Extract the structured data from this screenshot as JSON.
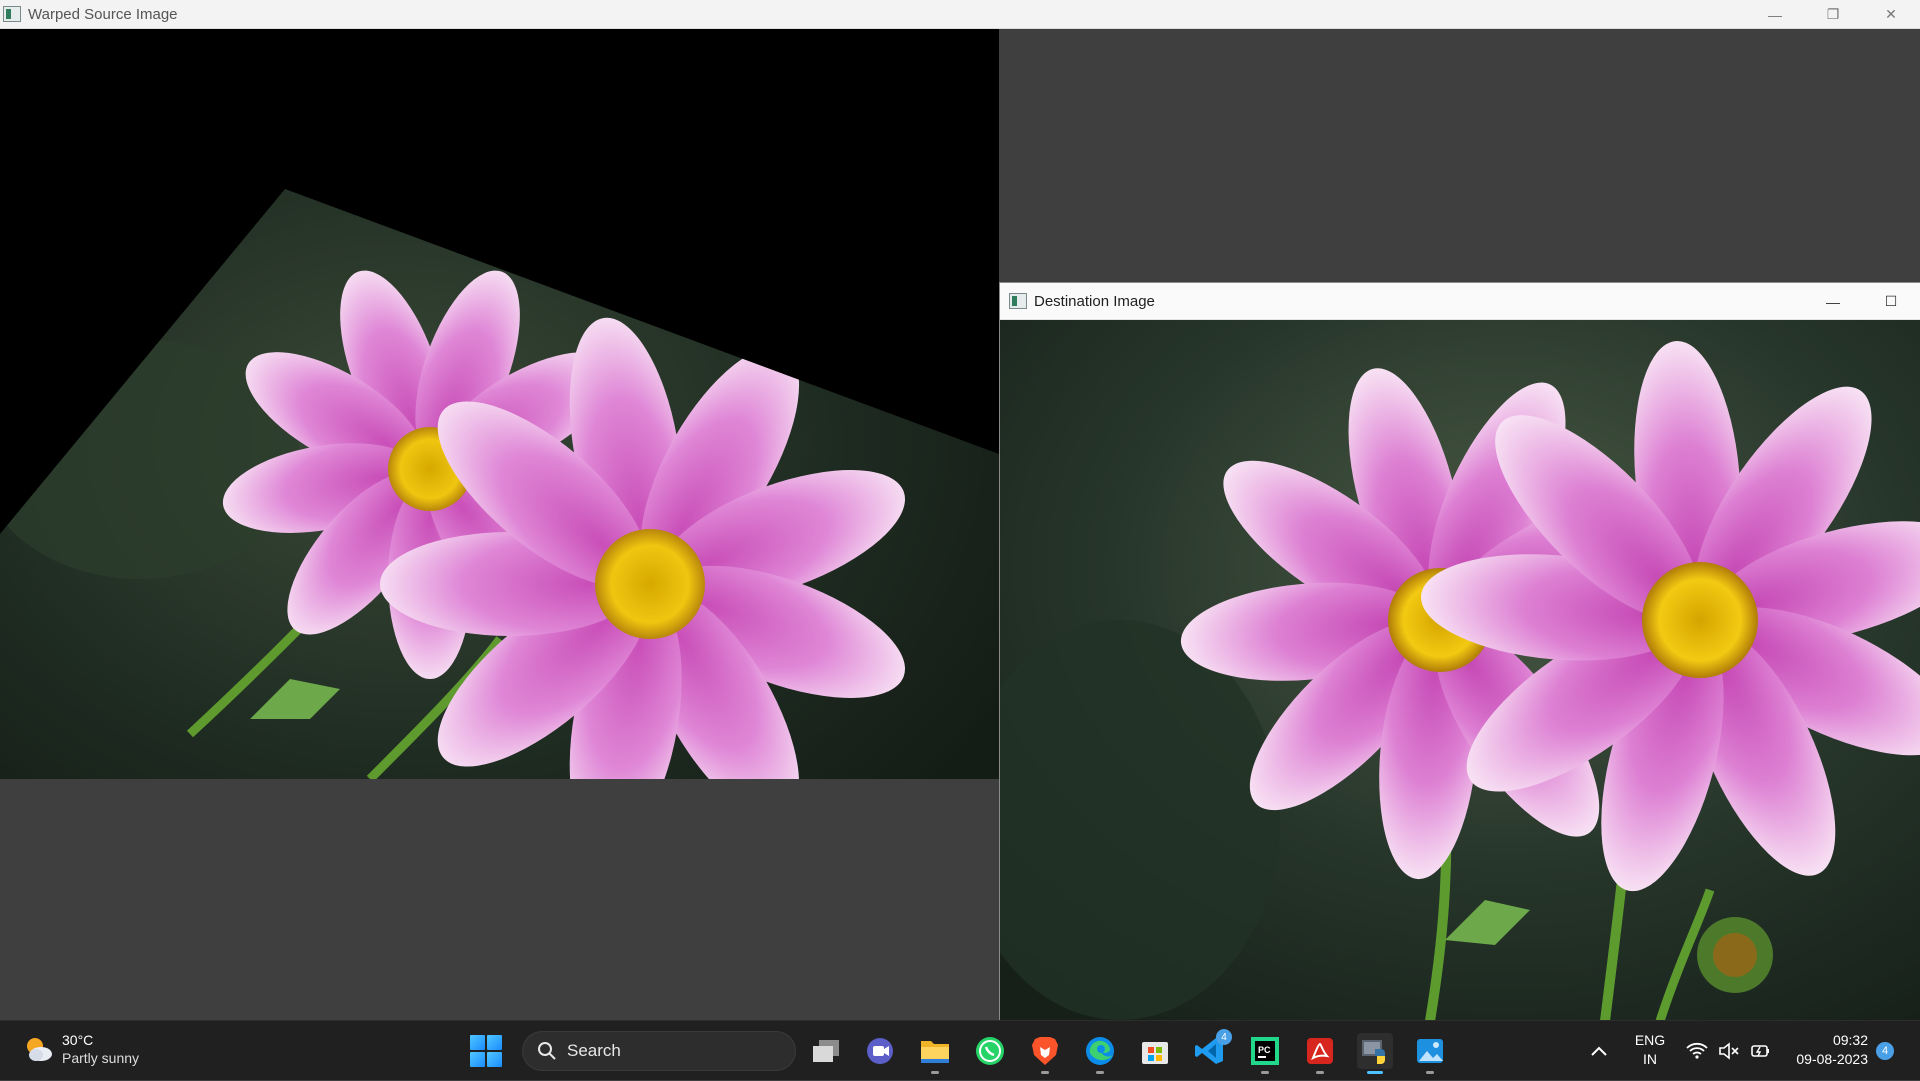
{
  "main_window": {
    "title": "Warped Source Image",
    "controls": {
      "minimize": "—",
      "restore": "❐",
      "close": "✕"
    }
  },
  "dest_window": {
    "title": "Destination Image",
    "controls": {
      "minimize": "—",
      "maximize": "☐"
    }
  },
  "taskbar": {
    "weather": {
      "temp": "30°C",
      "desc": "Partly sunny"
    },
    "search_placeholder": "Search",
    "apps": [
      {
        "name": "task-view"
      },
      {
        "name": "teams-meet"
      },
      {
        "name": "file-explorer"
      },
      {
        "name": "whatsapp"
      },
      {
        "name": "brave"
      },
      {
        "name": "edge"
      },
      {
        "name": "microsoft-store"
      },
      {
        "name": "vscode",
        "badge": "4"
      },
      {
        "name": "pycharm"
      },
      {
        "name": "acrobat"
      },
      {
        "name": "python"
      },
      {
        "name": "photos"
      }
    ],
    "language": {
      "line1": "ENG",
      "line2": "IN"
    },
    "time": "09:32",
    "date": "09-08-2023",
    "notifications": "4"
  },
  "colors": {
    "accent": "#4cc2ff",
    "taskbar_bg": "#202020",
    "window_bg": "#3f3f3f"
  }
}
